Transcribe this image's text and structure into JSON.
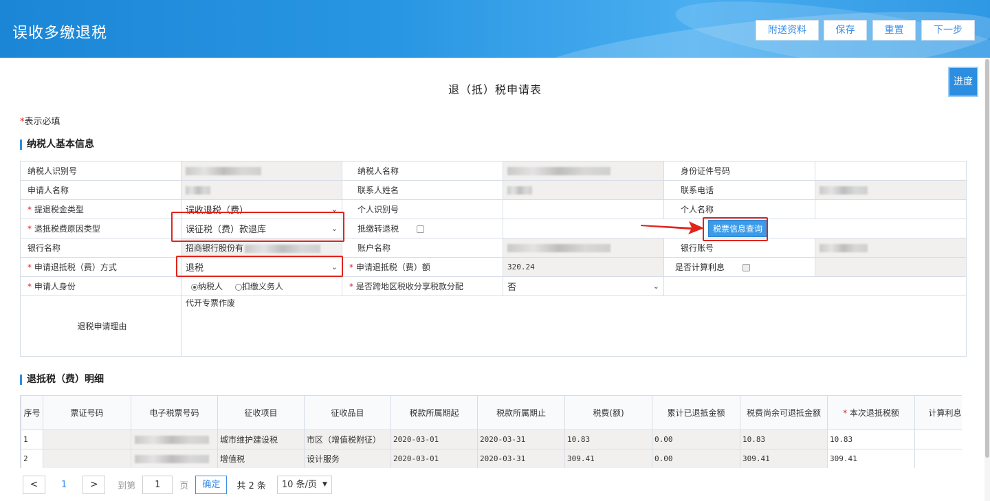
{
  "header": {
    "title": "误收多缴退税",
    "buttons": {
      "attach": "附送资料",
      "save": "保存",
      "reset": "重置",
      "next": "下一步"
    }
  },
  "progress_label": "进度",
  "form_title": "退（抵）税申请表",
  "required_note": {
    "star": "*",
    "text": "表示必填"
  },
  "basic_section_title": "纳税人基本信息",
  "basic": {
    "taxpayer_id_label": "纳税人识别号",
    "taxpayer_name_label": "纳税人名称",
    "id_number_label": "身份证件号码",
    "applicant_name_label": "申请人名称",
    "contact_name_label": "联系人姓名",
    "contact_phone_label": "联系电话",
    "refund_type_label": "提退税金类型",
    "refund_type_value": "误收退税（费）",
    "personal_id_label": "个人识别号",
    "personal_name_label": "个人名称",
    "reason_type_label": "退抵税费原因类型",
    "reason_type_value": "误征税（费）款退库",
    "offset_label": "抵缴转退税",
    "query_button": "税票信息查询",
    "bank_name_label": "银行名称",
    "bank_name_value": "招商银行股份有",
    "account_name_label": "账户名称",
    "bank_account_label": "银行账号",
    "method_label": "申请退抵税（费）方式",
    "method_value": "退税",
    "amount_label": "申请退抵税（费）额",
    "amount_value": "320.24",
    "interest_label": "是否计算利息",
    "identity_label": "申请人身份",
    "identity_options": [
      "纳税人",
      "扣缴义务人"
    ],
    "cross_region_label": "是否跨地区税收分享税款分配",
    "cross_region_value": "否",
    "reason_label": "退税申请理由",
    "reason_value": "代开专票作废"
  },
  "detail_section_title": "退抵税（费）明细",
  "detail": {
    "headers": [
      "序号",
      "票证号码",
      "电子税票号码",
      "征收项目",
      "征收品目",
      "税款所属期起",
      "税款所属期止",
      "税费(额)",
      "累计已退抵金额",
      "税费尚余可退抵金额",
      "本次退抵税额",
      "计算利息起"
    ],
    "rows": [
      [
        "1",
        "",
        "",
        "城市维护建设税",
        "市区（增值税附征）",
        "2020-03-01",
        "2020-03-31",
        "10.83",
        "0.00",
        "10.83",
        "10.83",
        ""
      ],
      [
        "2",
        "",
        "",
        "增值税",
        "设计服务",
        "2020-03-01",
        "2020-03-31",
        "309.41",
        "0.00",
        "309.41",
        "309.41",
        ""
      ]
    ]
  },
  "pager": {
    "prev": "<",
    "current": "1",
    "next": ">",
    "goto_label": "到第",
    "goto_value": "1",
    "page_unit": "页",
    "confirm": "确定",
    "total": "共 2 条",
    "page_size": "10 条/页"
  }
}
